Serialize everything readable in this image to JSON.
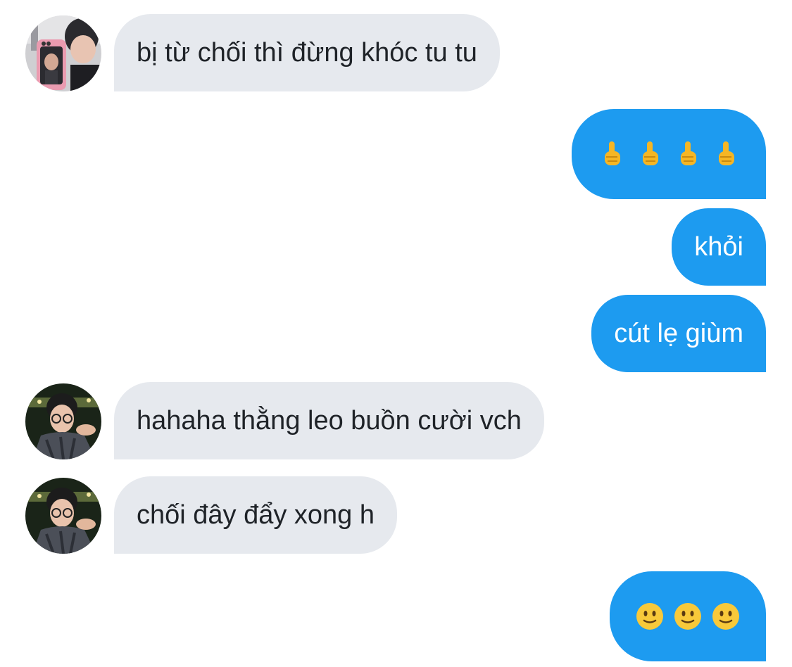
{
  "conversation": {
    "messages": [
      {
        "id": 0,
        "direction": "incoming",
        "text": "bị từ chối thì đừng khóc tu tu",
        "avatar": "avatar-photo-mirror-selfie"
      },
      {
        "id": 1,
        "direction": "outgoing",
        "emoji": [
          "middle-finger-emoji",
          "middle-finger-emoji",
          "middle-finger-emoji",
          "middle-finger-emoji"
        ]
      },
      {
        "id": 2,
        "direction": "outgoing",
        "text": "khỏi"
      },
      {
        "id": 3,
        "direction": "outgoing",
        "text": "cút lẹ giùm"
      },
      {
        "id": 4,
        "direction": "incoming",
        "text": "hahaha thằng leo buồn cười vch",
        "avatar": "avatar-photo-glasses-man"
      },
      {
        "id": 5,
        "direction": "incoming",
        "text": "chối đây đẩy xong h",
        "avatar": "avatar-photo-glasses-man"
      },
      {
        "id": 6,
        "direction": "outgoing",
        "emoji": [
          "slightly-smiling-face-emoji",
          "slightly-smiling-face-emoji",
          "slightly-smiling-face-emoji"
        ]
      }
    ]
  },
  "colors": {
    "incoming_bubble": "#e6e9ee",
    "outgoing_bubble": "#1d9bf0",
    "incoming_text": "#1f2328",
    "outgoing_text": "#ffffff"
  }
}
